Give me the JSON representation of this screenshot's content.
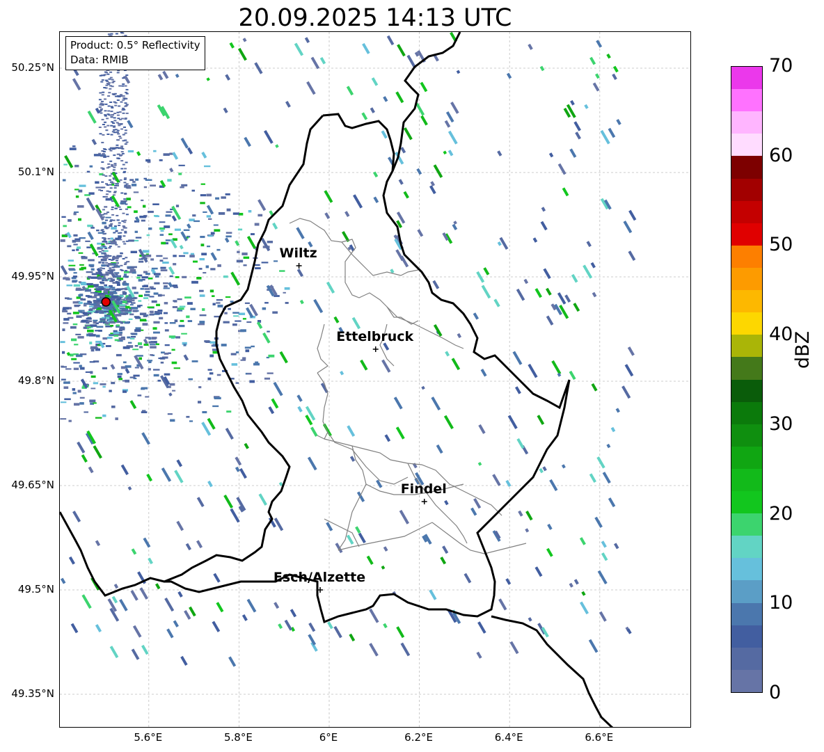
{
  "title": "20.09.2025 14:13 UTC",
  "info": {
    "product": "Product: 0.5° Reflectivity",
    "data": "Data: RMIB"
  },
  "axes": {
    "y_ticks": [
      {
        "value": 50.25,
        "label": "50.25°N"
      },
      {
        "value": 50.1,
        "label": "50.1°N"
      },
      {
        "value": 49.95,
        "label": "49.95°N"
      },
      {
        "value": 49.8,
        "label": "49.8°N"
      },
      {
        "value": 49.65,
        "label": "49.65°N"
      },
      {
        "value": 49.5,
        "label": "49.5°N"
      },
      {
        "value": 49.35,
        "label": "49.35°N"
      }
    ],
    "x_ticks": [
      {
        "value": 5.6,
        "label": "5.6°E"
      },
      {
        "value": 5.8,
        "label": "5.8°E"
      },
      {
        "value": 6.0,
        "label": "6°E"
      },
      {
        "value": 6.2,
        "label": "6.2°E"
      },
      {
        "value": 6.4,
        "label": "6.4°E"
      },
      {
        "value": 6.6,
        "label": "6.6°E"
      }
    ],
    "lon_range": [
      5.4,
      6.8
    ],
    "lat_range": [
      49.3,
      50.3
    ]
  },
  "cities": [
    {
      "name": "Wiltz",
      "lon": 5.933,
      "lat": 49.966
    },
    {
      "name": "Ettelbruck",
      "lon": 6.103,
      "lat": 49.846
    },
    {
      "name": "Findel",
      "lon": 6.211,
      "lat": 49.627
    },
    {
      "name": "Esch/Alzette",
      "lon": 5.98,
      "lat": 49.5
    }
  ],
  "radar_site": {
    "lon": 5.505,
    "lat": 49.914
  },
  "colorbar": {
    "label": "dBZ",
    "ticks": [
      "0",
      "10",
      "20",
      "30",
      "40",
      "50",
      "60",
      "70"
    ],
    "min": 0,
    "max": 70,
    "colors": [
      "#6674a6",
      "#556aa2",
      "#425ea0",
      "#4b77ad",
      "#5b9ec6",
      "#66c0dc",
      "#62d4c4",
      "#3cd46e",
      "#12c61e",
      "#12ba1a",
      "#10a612",
      "#0f8f0f",
      "#0b7a0b",
      "#0a5c0a",
      "#44791a",
      "#aab507",
      "#fdd700",
      "#fdb800",
      "#fd9b00",
      "#fd7f00",
      "#e00000",
      "#c40000",
      "#a20000",
      "#7d0000",
      "#ffdcff",
      "#ffb5ff",
      "#ff72ff",
      "#eb38eb"
    ]
  }
}
